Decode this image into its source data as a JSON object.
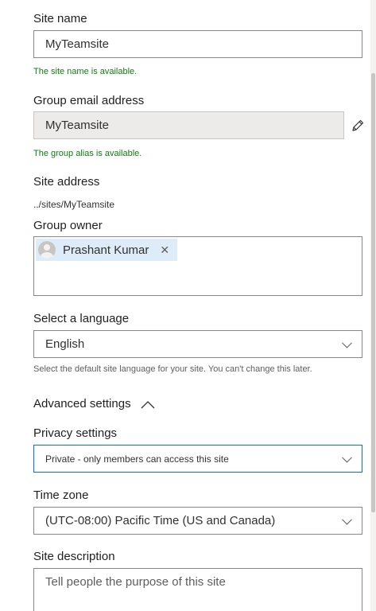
{
  "site_name": {
    "label": "Site name",
    "value": "MyTeamsite",
    "status": "The site name is available."
  },
  "group_email": {
    "label": "Group email address",
    "value": "MyTeamsite",
    "status": "The group alias is available.",
    "edit_icon": "pencil-icon"
  },
  "site_address": {
    "label": "Site address",
    "value": "../sites/MyTeamsite"
  },
  "group_owner": {
    "label": "Group owner",
    "owner_name": "Prashant Kumar",
    "remove_glyph": "✕",
    "avatar_icon": "person-avatar-icon"
  },
  "language": {
    "label": "Select a language",
    "selected": "English",
    "helper": "Select the default site language for your site. You can't change this later."
  },
  "advanced": {
    "label": "Advanced settings",
    "icon": "chevron-up-icon"
  },
  "privacy": {
    "label": "Privacy settings",
    "selected": "Private - only members can access this site"
  },
  "time_zone": {
    "label": "Time zone",
    "selected": "(UTC-08:00) Pacific Time (US and Canada)"
  },
  "description": {
    "label": "Site description",
    "placeholder": "Tell people the purpose of this site"
  },
  "colors": {
    "accent": "#0078d4",
    "success": "#107c10",
    "persona_bg": "#deecf9",
    "disabled_bg": "#edebe9"
  }
}
